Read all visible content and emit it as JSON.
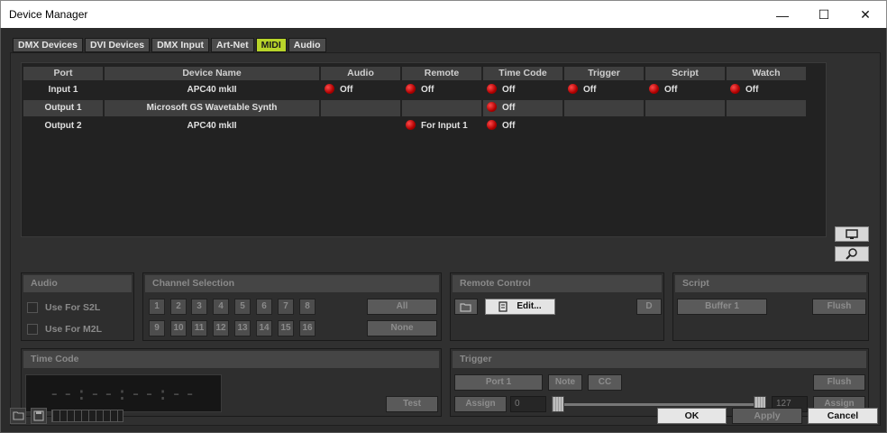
{
  "window": {
    "title": "Device Manager",
    "minimize_glyph": "—",
    "maximize_glyph": "☐",
    "close_glyph": "✕"
  },
  "tabs": [
    {
      "label": "DMX Devices"
    },
    {
      "label": "DVI Devices"
    },
    {
      "label": "DMX Input"
    },
    {
      "label": "Art-Net"
    },
    {
      "label": "MIDI"
    },
    {
      "label": "Audio"
    }
  ],
  "active_tab": "MIDI",
  "table": {
    "headers": [
      "Port",
      "Device Name",
      "Audio",
      "Remote",
      "Time Code",
      "Trigger",
      "Script",
      "Watch"
    ],
    "rows": [
      {
        "port": "Input 1",
        "device": "APC40 mkII",
        "audio": "Off",
        "remote": "Off",
        "timecode": "Off",
        "trigger": "Off",
        "script": "Off",
        "watch": "Off"
      },
      {
        "port": "Output 1",
        "device": "Microsoft GS Wavetable Synth",
        "audio": "",
        "remote": "",
        "timecode": "Off",
        "trigger": "",
        "script": "",
        "watch": ""
      },
      {
        "port": "Output 2",
        "device": "APC40 mkII",
        "audio": "",
        "remote": "For Input 1",
        "timecode": "Off",
        "trigger": "",
        "script": "",
        "watch": ""
      }
    ]
  },
  "side_icons": [
    "monitor-icon",
    "magnifier-icon"
  ],
  "audio_group": {
    "title": "Audio",
    "options": [
      "Use For S2L",
      "Use For M2L"
    ]
  },
  "channel_group": {
    "title": "Channel Selection",
    "channels": [
      "1",
      "2",
      "3",
      "4",
      "5",
      "6",
      "7",
      "8",
      "9",
      "10",
      "11",
      "12",
      "13",
      "14",
      "15",
      "16"
    ],
    "all_label": "All",
    "none_label": "None"
  },
  "remote_group": {
    "title": "Remote Control",
    "edit_label": "Edit...",
    "d_label": "D"
  },
  "script_group": {
    "title": "Script",
    "buffer_label": "Buffer 1",
    "flush_label": "Flush"
  },
  "timecode_group": {
    "title": "Time Code",
    "display": "--:--:--:--",
    "test_label": "Test"
  },
  "trigger_group": {
    "title": "Trigger",
    "port_label": "Port 1",
    "note_label": "Note",
    "cc_label": "CC",
    "flush_label": "Flush",
    "assign_label": "Assign",
    "assign2_label": "Assign",
    "min_value": "0",
    "max_value": "127"
  },
  "footer": {
    "ok_label": "OK",
    "apply_label": "Apply",
    "cancel_label": "Cancel"
  },
  "colors": {
    "active_tab": "#b8d42a",
    "led_red": "#d40000",
    "background": "#2b2b2b"
  }
}
